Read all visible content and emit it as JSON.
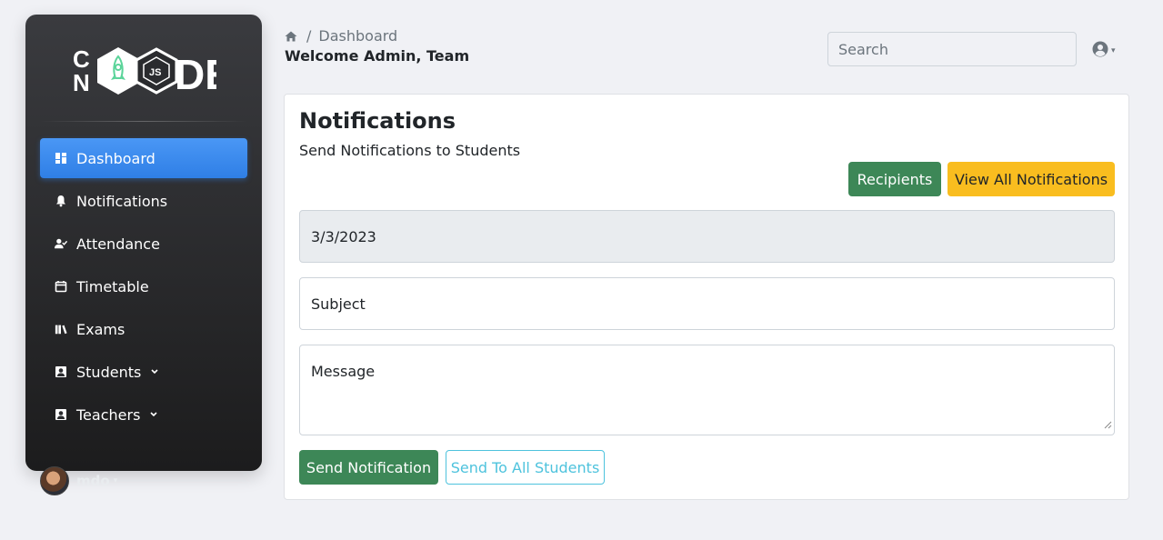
{
  "sidebar": {
    "logo_text": "CNODE JS",
    "items": [
      {
        "label": "Dashboard",
        "icon": "dashboard-icon",
        "active": true
      },
      {
        "label": "Notifications",
        "icon": "bell-icon"
      },
      {
        "label": "Attendance",
        "icon": "user-check-icon"
      },
      {
        "label": "Timetable",
        "icon": "calendar-edit-icon"
      },
      {
        "label": "Exams",
        "icon": "books-icon"
      },
      {
        "label": "Students",
        "icon": "student-icon",
        "has_dropdown": true
      },
      {
        "label": "Teachers",
        "icon": "teacher-icon",
        "has_dropdown": true
      }
    ],
    "user": {
      "name": "mdo"
    }
  },
  "header": {
    "breadcrumb": {
      "home_icon": "home-icon",
      "current": "Dashboard",
      "separator": "/"
    },
    "welcome": "Welcome Admin, Team",
    "search": {
      "placeholder": "Search",
      "value": ""
    },
    "user_menu_icon": "user-circle-icon"
  },
  "card": {
    "title": "Notifications",
    "subtitle": "Send Notifications to Students",
    "recipients_label": "Recipients",
    "view_all_label": "View All Notifications",
    "date_value": "3/3/2023",
    "subject_placeholder": "Subject",
    "message_placeholder": "Message",
    "send_label": "Send Notification",
    "send_all_label": "Send To All Students"
  },
  "colors": {
    "primary": "#2f7fe6",
    "success": "#3d8757",
    "warning": "#f9bd1f",
    "info": "#4ec3dd",
    "sidebar_dark": "#1c1c1d",
    "page_bg": "#f0f1f5"
  }
}
